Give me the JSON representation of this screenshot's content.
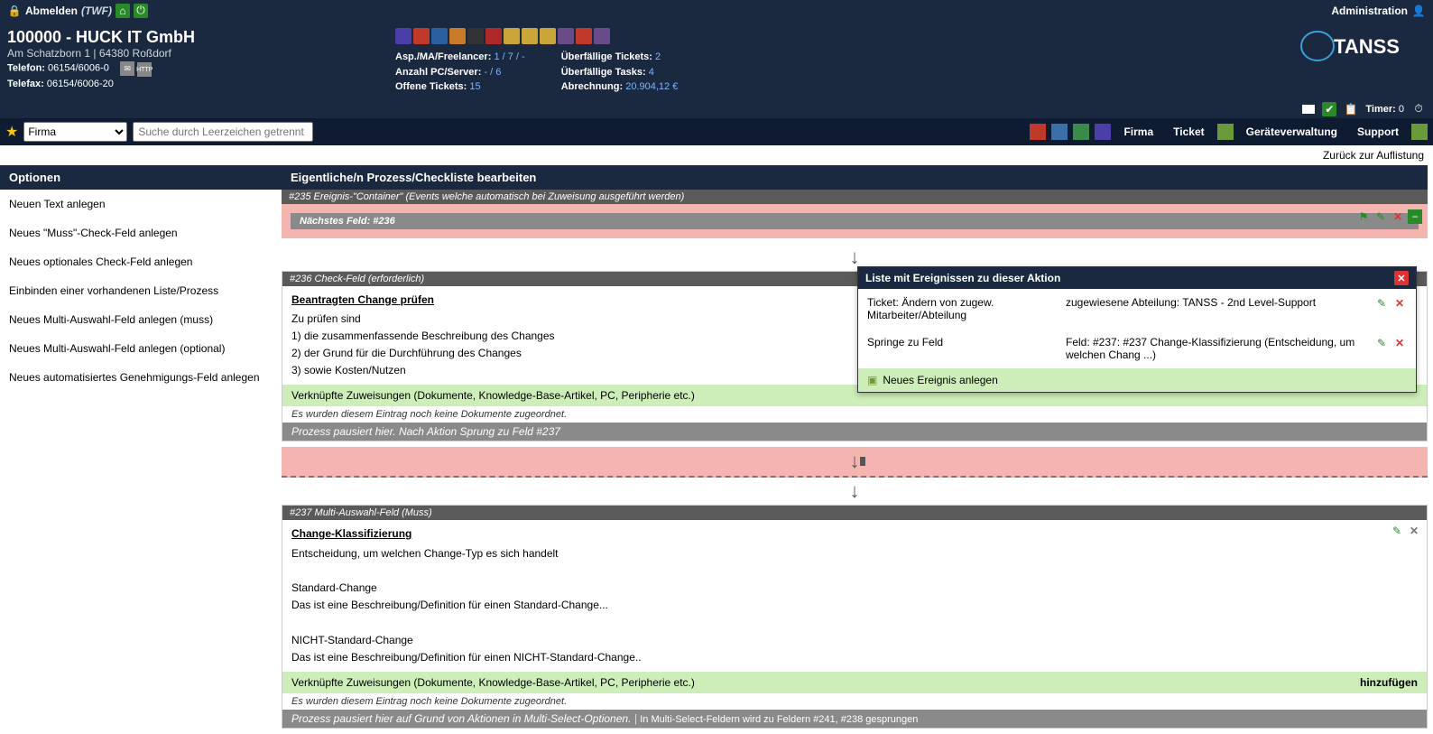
{
  "topbar": {
    "logout": "Abmelden",
    "user": "(TWF)",
    "admin": "Administration"
  },
  "company": {
    "title": "100000 - HUCK IT GmbH",
    "address": "Am Schatzborn 1 | 64380 Roßdorf",
    "tel_label": "Telefon:",
    "tel": "06154/6006-0",
    "fax_label": "Telefax:",
    "fax": "06154/6006-20"
  },
  "stats1": {
    "l1": "Asp./MA/Freelancer:",
    "v1": "1 / 7 / -",
    "l2": "Anzahl PC/Server:",
    "v2": "- / 6",
    "l3": "Offene Tickets:",
    "v3": "15"
  },
  "stats2": {
    "l1": "Überfällige Tickets:",
    "v1": "2",
    "l2": "Überfällige Tasks:",
    "v2": "4",
    "l3": "Abrechnung:",
    "v3": "20.904,12 €"
  },
  "timer": {
    "label": "Timer:",
    "val": "0"
  },
  "nav": {
    "select": "Firma",
    "search_ph": "Suche durch Leerzeichen getrennt",
    "firma": "Firma",
    "ticket": "Ticket",
    "geraete": "Geräteverwaltung",
    "support": "Support"
  },
  "backlink": "Zurück zur Auflistung",
  "sidebar": {
    "header": "Optionen",
    "items": [
      "Neuen Text anlegen",
      "Neues \"Muss\"-Check-Feld anlegen",
      "Neues optionales Check-Feld anlegen",
      "Einbinden einer vorhandenen Liste/Prozess",
      "Neues Multi-Auswahl-Feld anlegen (muss)",
      "Neues Multi-Auswahl-Feld anlegen (optional)",
      "Neues automatisiertes Genehmigungs-Feld anlegen"
    ]
  },
  "main_header": "Eigentliche/n Prozess/Checkliste bearbeiten",
  "block235": {
    "title": "#235 Ereignis-\"Container\" (Events welche automatisch bei Zuweisung ausgeführt werden)",
    "next": "Nächstes Feld: #236"
  },
  "block236": {
    "title": "#236 Check-Feld (erforderlich)",
    "lead": "Beantragten Change prüfen",
    "p0": "Zu prüfen sind",
    "p1": "1) die zusammenfassende Beschreibung des Changes",
    "p2": "2) der Grund für die Durchführung des Changes",
    "p3": "3) sowie Kosten/Nutzen",
    "link_title": "Verknüpfte Zuweisungen (Dokumente, Knowledge-Base-Artikel, PC, Peripherie etc.)",
    "link_none": "Es wurden diesem Eintrag noch keine Dokumente zugeordnet.",
    "pause": "Prozess pausiert hier. Nach Aktion Sprung zu Feld #237"
  },
  "block237": {
    "title": "#237 Multi-Auswahl-Feld (Muss)",
    "lead": "Change-Klassifizierung",
    "p0": "Entscheidung, um welchen Change-Typ es sich handelt",
    "h1": "Standard-Change",
    "p1": "Das ist eine Beschreibung/Definition für einen Standard-Change...",
    "h2": "NICHT-Standard-Change",
    "p2": "Das ist eine Beschreibung/Definition für einen NICHT-Standard-Change..",
    "link_title": "Verknüpfte Zuweisungen (Dokumente, Knowledge-Base-Artikel, PC, Peripherie etc.)",
    "add": "hinzufügen",
    "link_none": "Es wurden diesem Eintrag noch keine Dokumente zugeordnet.",
    "pause": "Prozess pausiert hier auf Grund von Aktionen in Multi-Select-Optionen.",
    "pause2": "In Multi-Select-Feldern wird zu Feldern #241, #238 gesprungen"
  },
  "popup": {
    "title": "Liste mit Ereignissen zu dieser Aktion",
    "r1c1": "Ticket: Ändern von zugew. Mitarbeiter/Abteilung",
    "r1c2": "zugewiesene Abteilung: TANSS - 2nd Level-Support",
    "r2c1": "Springe zu Feld",
    "r2c2": "Feld: #237: #237 Change-Klassifizierung (Entscheidung, um welchen Chang ...)",
    "new": "Neues Ereignis anlegen"
  }
}
